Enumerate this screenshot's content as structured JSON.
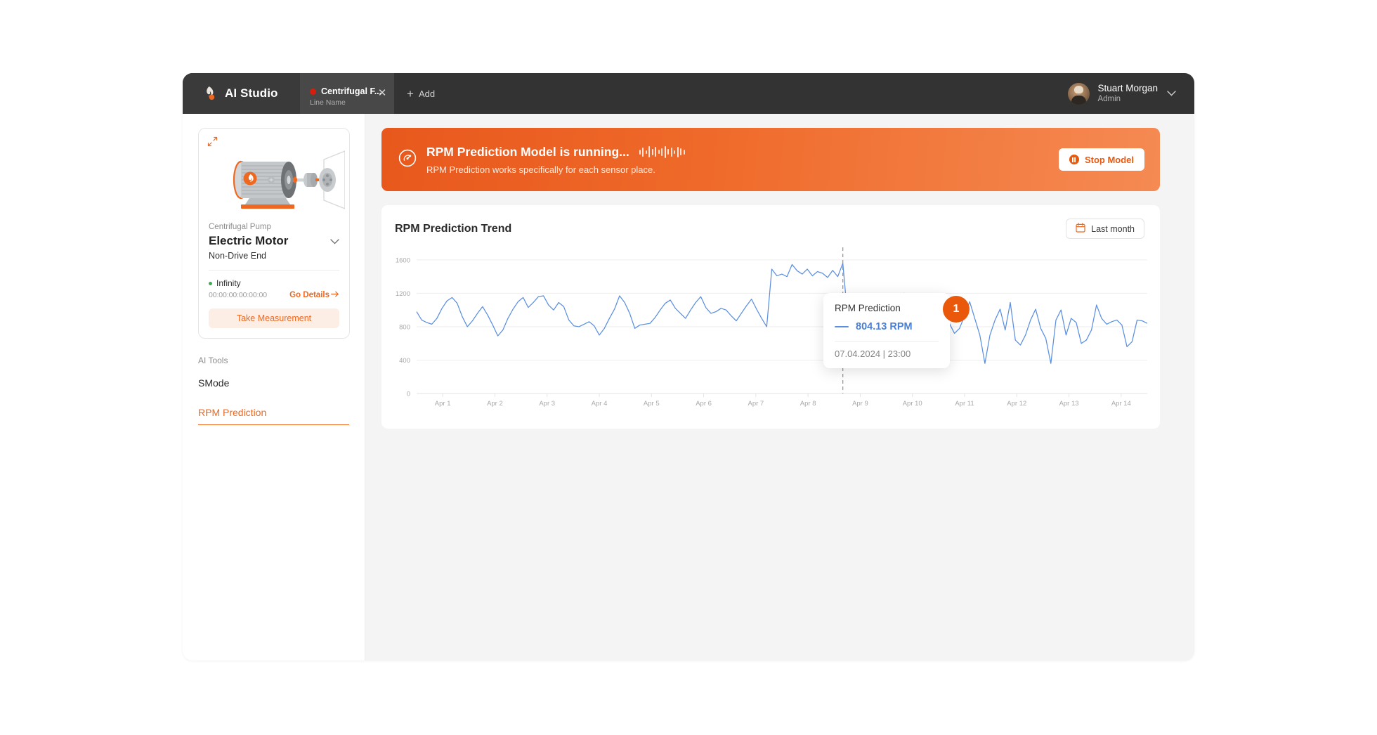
{
  "app": {
    "brand": "AI Studio",
    "logo_icon": "flame-logo-icon"
  },
  "tab": {
    "title": "Centrifugal F...",
    "subtitle": "Line Name",
    "status_dot_color": "#d91c0b",
    "close_icon": "close-icon",
    "add_label": "Add",
    "add_icon": "plus-icon"
  },
  "user": {
    "name": "Stuart Morgan",
    "role": "Admin",
    "chevron_icon": "chevron-down-icon",
    "avatar_icon": "avatar"
  },
  "sidebar": {
    "expand_icon": "expand-arrows-icon",
    "device_image_icon": "electric-motor-illustration",
    "category": "Centrifugal Pump",
    "title": "Electric Motor",
    "title_chevron_icon": "chevron-down-icon",
    "position": "Non-Drive End",
    "status_label": "Infinity",
    "status_color": "#3faa5a",
    "mac_address": "00:00:00:00:00:00",
    "go_details_label": "Go Details",
    "go_details_icon": "arrow-right-icon",
    "take_measurement_label": "Take Measurement",
    "ai_tools_label": "AI Tools",
    "tools": [
      {
        "label": "SMode",
        "active": false
      },
      {
        "label": "RPM Prediction",
        "active": true
      }
    ],
    "accent_color": "#ef6820"
  },
  "banner": {
    "icon": "gauge-icon",
    "title": "RPM Prediction Model is running...",
    "waveform_icon": "audio-waveform-icon",
    "subtitle": "RPM Prediction works specifically for each sensor place.",
    "stop_label": "Stop Model",
    "stop_icon": "pause-circle-icon",
    "gradient_from": "#e8581c",
    "gradient_to": "#f58a53"
  },
  "chart_card": {
    "title": "RPM Prediction Trend",
    "range_label": "Last month",
    "range_icon": "calendar-icon"
  },
  "tooltip": {
    "title": "RPM Prediction",
    "value": "804.13 RPM",
    "datetime": "07.04.2024 | 23:00",
    "badge": "1",
    "series_color": "#5b8fe0",
    "badge_color": "#ea580c"
  },
  "chart_data": {
    "type": "line",
    "title": "RPM Prediction Trend",
    "xlabel": "",
    "ylabel": "",
    "ylim": [
      0,
      1700
    ],
    "yticks": [
      0,
      400,
      800,
      1200,
      1600
    ],
    "grid": true,
    "legend": false,
    "line_color": "#5b8fe0",
    "x_tick_labels": [
      "Apr 1",
      "Apr 2",
      "Apr 3",
      "Apr 4",
      "Apr 5",
      "Apr 6",
      "Apr 7",
      "Apr 8",
      "Apr 9",
      "Apr 10",
      "Apr 11",
      "Apr 12",
      "Apr 13",
      "Apr 14"
    ],
    "marker_line": {
      "label": "Apr 8",
      "x_index": 84,
      "style": "dashed",
      "color": "#9a9a9a"
    },
    "series": [
      {
        "name": "RPM Prediction",
        "values": [
          980,
          880,
          850,
          830,
          900,
          1020,
          1110,
          1150,
          1080,
          920,
          800,
          870,
          960,
          1040,
          940,
          820,
          690,
          760,
          900,
          1010,
          1100,
          1150,
          1030,
          1090,
          1160,
          1170,
          1060,
          1000,
          1090,
          1040,
          880,
          810,
          800,
          830,
          860,
          810,
          700,
          780,
          900,
          1010,
          1170,
          1090,
          960,
          780,
          820,
          830,
          840,
          910,
          1000,
          1080,
          1120,
          1020,
          960,
          900,
          1000,
          1090,
          1160,
          1030,
          960,
          980,
          1020,
          1000,
          930,
          870,
          960,
          1050,
          1130,
          1010,
          900,
          800,
          1490,
          1410,
          1430,
          1400,
          1545,
          1470,
          1430,
          1490,
          1410,
          1460,
          1440,
          1390,
          1475,
          1400,
          1560,
          880,
          870,
          900,
          1000,
          930,
          960,
          880,
          800,
          700,
          760,
          820,
          1200,
          560,
          360,
          520,
          700,
          890,
          780,
          760,
          800,
          840,
          720,
          780,
          930,
          1100,
          900,
          700,
          360,
          700,
          880,
          1010,
          760,
          1090,
          640,
          580,
          700,
          880,
          1010,
          780,
          660,
          360,
          880,
          1000,
          700,
          900,
          850,
          600,
          640,
          760,
          1060,
          900,
          830,
          860,
          880,
          820,
          560,
          620,
          880,
          870,
          840
        ]
      }
    ]
  }
}
